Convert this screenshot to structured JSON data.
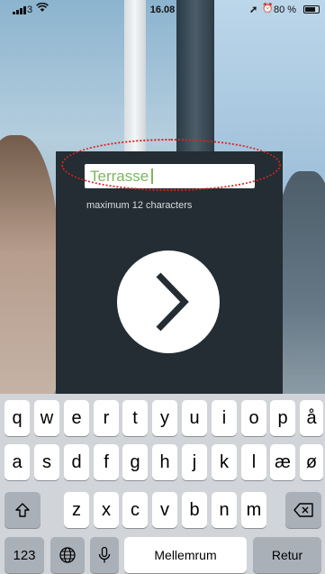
{
  "status_bar": {
    "carrier": "3",
    "time": "16.08",
    "battery_text": "80 %",
    "battery_level": 0.8,
    "icons": [
      "signal-icon",
      "wifi-icon",
      "location-icon",
      "alarm-icon",
      "battery-icon"
    ]
  },
  "name_field": {
    "value": "Terrasse",
    "hint": "maximum 12 characters"
  },
  "next_button": {
    "icon": "chevron-right-icon"
  },
  "colors": {
    "panel": "#232d33",
    "input_text": "#7bb55f",
    "highlight": "#d9231e",
    "keyboard_bg": "#d1d4d9"
  },
  "keyboard": {
    "row1": [
      "q",
      "w",
      "e",
      "r",
      "t",
      "y",
      "u",
      "i",
      "o",
      "p",
      "å"
    ],
    "row2": [
      "a",
      "s",
      "d",
      "f",
      "g",
      "h",
      "j",
      "k",
      "l",
      "æ",
      "ø"
    ],
    "row3": [
      "z",
      "x",
      "c",
      "v",
      "b",
      "n",
      "m"
    ],
    "shift_icon": "shift-icon",
    "backspace_icon": "backspace-icon",
    "numbers_label": "123",
    "globe_icon": "globe-icon",
    "mic_icon": "microphone-icon",
    "space_label": "Mellemrum",
    "return_label": "Retur"
  }
}
